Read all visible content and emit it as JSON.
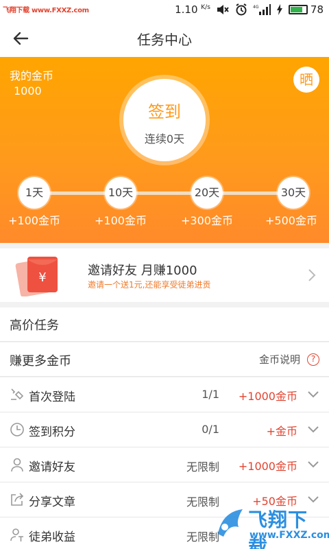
{
  "watermark": {
    "top_left": "飞翔下载 www.FXXZ.com",
    "brand": "飞翔下载",
    "url": "www.FXXZ.com"
  },
  "status_bar": {
    "speed": "1.10",
    "speed_unit": "K/s",
    "battery": "78",
    "battery_level": 0.78,
    "battery_color": "#2fb34a"
  },
  "header": {
    "title": "任务中心",
    "back_icon": "arrow-left-icon"
  },
  "coins": {
    "label": "我的金币",
    "value": "1000"
  },
  "share_label": "晒",
  "sign_in": {
    "label": "签到",
    "streak": "连续0天"
  },
  "milestones": [
    {
      "day": "1天",
      "reward": "+100金币"
    },
    {
      "day": "10天",
      "reward": "+100金币"
    },
    {
      "day": "20天",
      "reward": "+300金币"
    },
    {
      "day": "30天",
      "reward": "+500金币"
    }
  ],
  "invite": {
    "title": "邀请好友 月赚1000",
    "subtitle": "邀请一个送1元,还能享受徒弟进贡",
    "icon": "red-envelope-icon"
  },
  "section": {
    "title": "高价任务"
  },
  "earn_more": {
    "title": "赚更多金币",
    "help_label": "金币说明",
    "help_icon": "?"
  },
  "tasks": [
    {
      "name": "首次登陆",
      "progress": "1/1",
      "reward": "+1000金币",
      "icon": "login-icon"
    },
    {
      "name": "签到积分",
      "progress": "0/1",
      "reward": "+金币",
      "icon": "clock-icon"
    },
    {
      "name": "邀请好友",
      "progress": "无限制",
      "reward": "+1000金币",
      "icon": "person-icon"
    },
    {
      "name": "分享文章",
      "progress": "无限制",
      "reward": "+50金币",
      "icon": "share-icon"
    },
    {
      "name": "徒弟收益",
      "progress": "无限制",
      "reward": "",
      "icon": "income-icon"
    }
  ],
  "colors": {
    "accent": "#ff9a1c",
    "reward_red": "#e2432f",
    "invite_orange": "#ef7a2a"
  }
}
